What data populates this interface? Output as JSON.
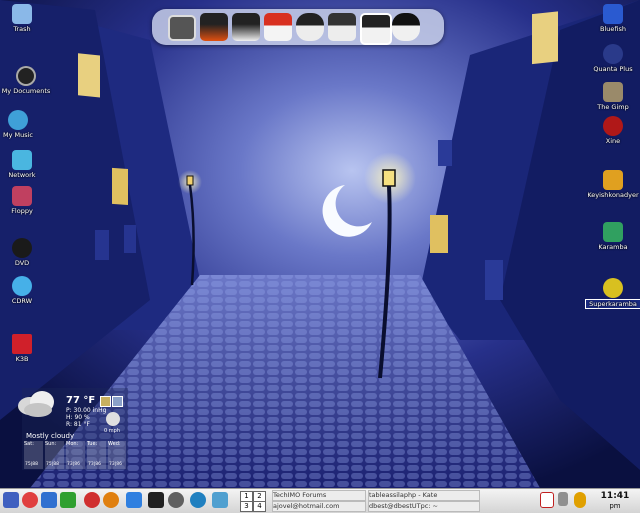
{
  "desktop": {
    "left_icons": [
      {
        "label": "Trash",
        "icon": "trash-icon",
        "color": "#8ab8e8"
      },
      {
        "label": "My Documents",
        "icon": "documents-icon",
        "color": "#222222"
      },
      {
        "label": "My Music",
        "icon": "music-icon",
        "color": "#3fa0d8"
      },
      {
        "label": "Network",
        "icon": "network-icon",
        "color": "#4ab6e0"
      },
      {
        "label": "Floppy",
        "icon": "floppy-icon",
        "color": "#c04060"
      },
      {
        "label": "DVD",
        "icon": "dvd-icon",
        "color": "#1a1a1a"
      },
      {
        "label": "CDRW",
        "icon": "cdrw-icon",
        "color": "#46b0e8"
      },
      {
        "label": "K3B",
        "icon": "k3b-icon",
        "color": "#d0202a"
      }
    ],
    "right_icons": [
      {
        "label": "Bluefish",
        "icon": "bluefish-icon",
        "color": "#2a5ad0"
      },
      {
        "label": "Quanta Plus",
        "icon": "quanta-icon",
        "color": "#2a3a8a"
      },
      {
        "label": "The Gimp",
        "icon": "gimp-icon",
        "color": "#9a8a6a"
      },
      {
        "label": "Xine",
        "icon": "xine-icon",
        "color": "#b01818"
      },
      {
        "label": "Keyishkonadyer",
        "icon": "keyboard-icon",
        "color": "#e0a020"
      },
      {
        "label": "Karamba",
        "icon": "karamba-icon",
        "color": "#30a060"
      },
      {
        "label": "Superkaramba",
        "icon": "superkaramba-icon",
        "color": "#d8c020"
      }
    ]
  },
  "dock": {
    "items": [
      {
        "icon": "monitor-icon",
        "color": "#555555"
      },
      {
        "icon": "tux-fire-icon",
        "color": "#e05010"
      },
      {
        "icon": "tux-editor-icon",
        "color": "#f0f0f0"
      },
      {
        "icon": "home-icon",
        "color": "#d83020"
      },
      {
        "icon": "tux-chat-icon",
        "color": "#222222"
      },
      {
        "icon": "tux-camera-icon",
        "color": "#333333"
      },
      {
        "icon": "tux-mail-icon",
        "color": "#222222"
      },
      {
        "icon": "tux-search-icon",
        "color": "#111111"
      }
    ]
  },
  "weather": {
    "temperature": "77 °F",
    "pressure": "P: 30.00 inHg",
    "humidity": "H: 90 %",
    "feels": "R: 81 °F",
    "wind": "0 mph",
    "condition": "Mostly cloudy",
    "days": [
      "Sat:",
      "Sun:",
      "Mon:",
      "Tue:",
      "Wed:"
    ],
    "temps": [
      "75|88",
      "75|88",
      "73|86",
      "73|86",
      "73|86"
    ]
  },
  "taskbar": {
    "quick_icons": [
      {
        "icon": "k-menu-icon",
        "color": "#4060c0"
      },
      {
        "icon": "lifebuoy-icon",
        "color": "#e04040"
      },
      {
        "icon": "tools-icon",
        "color": "#3070d0"
      },
      {
        "icon": "star-icon",
        "color": "#30a030"
      },
      {
        "icon": "bug-icon",
        "color": "#d03030"
      },
      {
        "icon": "orange-icon",
        "color": "#e08010"
      },
      {
        "icon": "folder-icon",
        "color": "#3080e0"
      },
      {
        "icon": "terminal-icon",
        "color": "#202020"
      },
      {
        "icon": "speaker-icon",
        "color": "#606060"
      },
      {
        "icon": "globe-icon",
        "color": "#2080c0"
      },
      {
        "icon": "chat-icon",
        "color": "#50a0d0"
      }
    ],
    "pager": [
      "1",
      "2",
      "3",
      "4"
    ],
    "tasks": [
      "TechIMO Forums",
      "tableassilaphp - Kate",
      "ajovel@hotmail.com",
      "dbest@dbestUTpc: ~"
    ],
    "tray_icons": [
      {
        "icon": "calendar-icon",
        "color": "#c02020"
      },
      {
        "icon": "tray-icon",
        "color": "#909090"
      },
      {
        "icon": "user-icon",
        "color": "#e0a000"
      }
    ],
    "clock_time": "11:41",
    "clock_ampm": "pm"
  }
}
